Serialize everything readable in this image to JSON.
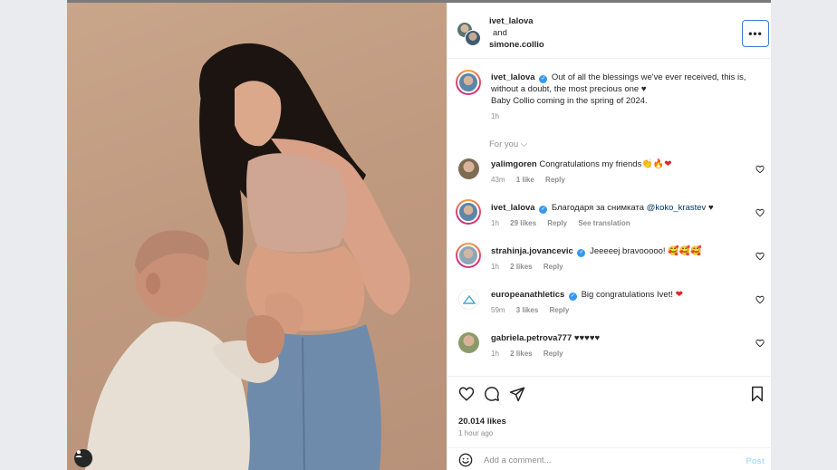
{
  "post": {
    "photo_alt": "",
    "header": {
      "user1": "ivet_lalova",
      "and_label": "and",
      "user2": "simone.collio",
      "more_label": "•••"
    },
    "caption": {
      "username": "ivet_lalova",
      "line1": "Out of all the blessings we've ever received, this is, without a doubt, the most precious one ♥",
      "line2": "Baby Collio coming in the spring of 2024.",
      "time": "1h"
    },
    "for_you_label": "For you",
    "comments": [
      {
        "username": "yalimgoren",
        "text": "Congratulations my friends",
        "emoji": "👏🔥",
        "heart": "❤",
        "time": "43m",
        "likes": "1 like",
        "reply": "Reply",
        "verified": false
      },
      {
        "username": "ivet_lalova",
        "text": "Благодаря за снимката",
        "mention": "@koko_krastev",
        "heart": "♥",
        "time": "1h",
        "likes": "29 likes",
        "reply": "Reply",
        "translate": "See translation",
        "verified": true
      },
      {
        "username": "strahinja.jovancevic",
        "text": "Jeeeeej bravooooo!",
        "emoji": "🥰🥰🥰",
        "time": "1h",
        "likes": "2 likes",
        "reply": "Reply",
        "verified": true
      },
      {
        "username": "europeanathletics",
        "text": "Big congratulations Ivet!",
        "heart": "❤",
        "time": "59m",
        "likes": "3 likes",
        "reply": "Reply",
        "verified": true
      },
      {
        "username": "gabriela.petrova777",
        "text": "♥♥♥♥♥",
        "time": "1h",
        "likes": "2 likes",
        "reply": "Reply",
        "verified": false
      }
    ],
    "likes": "20.014 likes",
    "posted": "1 hour ago",
    "add_comment_placeholder": "Add a comment...",
    "post_label": "Post"
  },
  "colors": {
    "accent_blue": "#3897f0",
    "focus_border": "#3b7bd4",
    "muted": "#8e8e8e",
    "like_red": "#e0242f"
  },
  "icons": [
    "more-horizontal-icon",
    "heart-icon",
    "comment-icon",
    "share-icon",
    "bookmark-icon",
    "smile-icon",
    "verified-icon",
    "user-tag-icon"
  ]
}
